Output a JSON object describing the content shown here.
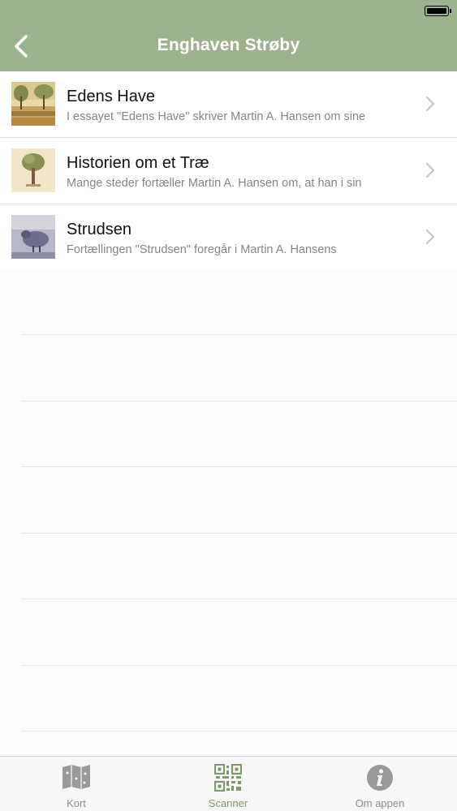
{
  "header": {
    "title": "Enghaven Strøby"
  },
  "list": {
    "items": [
      {
        "title": "Edens Have",
        "subtitle": "I essayet \"Edens Have\" skriver Martin A. Hansen om sine"
      },
      {
        "title": "Historien om et Træ",
        "subtitle": "Mange steder fortæller Martin A. Hansen om, at han i sin"
      },
      {
        "title": "Strudsen",
        "subtitle": "Fortællingen \"Strudsen\" foregår i Martin A. Hansens"
      }
    ]
  },
  "tabbar": {
    "tabs": [
      {
        "label": "Kort",
        "icon": "map-icon"
      },
      {
        "label": "Scanner",
        "icon": "qr-code-icon"
      },
      {
        "label": "Om appen",
        "icon": "info-icon"
      }
    ],
    "active_index": 1
  },
  "colors": {
    "header": "#9db38f",
    "accent": "#7d9a6a",
    "inactive": "#8e8e8e"
  }
}
